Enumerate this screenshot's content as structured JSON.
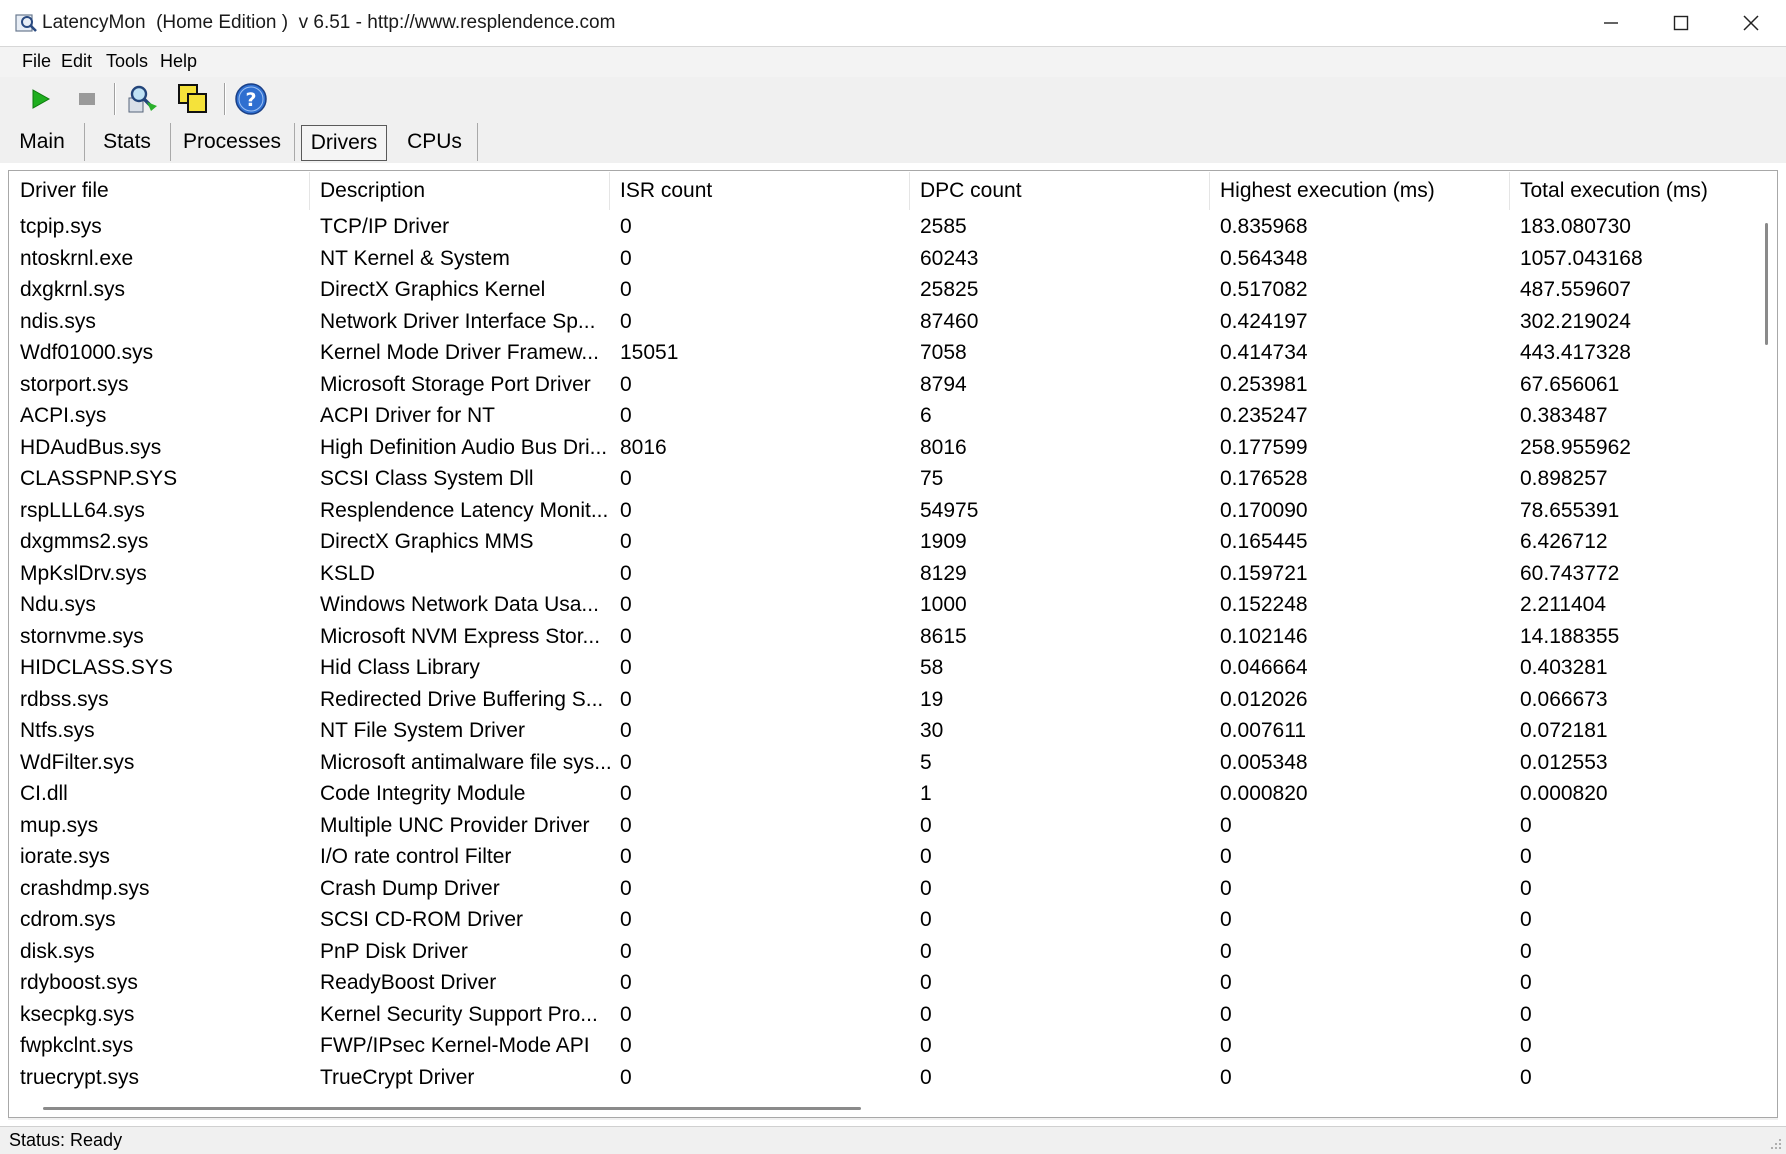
{
  "window": {
    "title": "LatencyMon  (Home Edition )  v 6.51 - http://www.resplendence.com",
    "icons": {
      "app": "latencymon-app-icon",
      "minimize": "minimize-icon",
      "maximize": "maximize-icon",
      "close": "close-icon"
    }
  },
  "menu": {
    "items": [
      "File",
      "Edit",
      "Tools",
      "Help"
    ]
  },
  "toolbar": {
    "buttons": [
      {
        "name": "start",
        "icon": "play-icon",
        "color": "#1fae1f"
      },
      {
        "name": "stop",
        "icon": "stop-icon",
        "color": "#9a9a9a"
      },
      {
        "name": "analyze",
        "icon": "magnifier-icon"
      },
      {
        "name": "windows",
        "icon": "windows-icon"
      },
      {
        "name": "help",
        "icon": "help-icon",
        "color": "#2f6fd0"
      }
    ]
  },
  "tabs": [
    {
      "label": "Main",
      "active": false
    },
    {
      "label": "Stats",
      "active": false
    },
    {
      "label": "Processes",
      "active": false
    },
    {
      "label": "Drivers",
      "active": true
    },
    {
      "label": "CPUs",
      "active": false
    }
  ],
  "table": {
    "columns": [
      "Driver file",
      "Description",
      "ISR count",
      "DPC count",
      "Highest execution (ms)",
      "Total execution (ms)"
    ],
    "rows": [
      [
        "tcpip.sys",
        "TCP/IP Driver",
        "0",
        "2585",
        "0.835968",
        "183.080730"
      ],
      [
        "ntoskrnl.exe",
        "NT Kernel & System",
        "0",
        "60243",
        "0.564348",
        "1057.043168"
      ],
      [
        "dxgkrnl.sys",
        "DirectX Graphics Kernel",
        "0",
        "25825",
        "0.517082",
        "487.559607"
      ],
      [
        "ndis.sys",
        "Network Driver Interface Sp...",
        "0",
        "87460",
        "0.424197",
        "302.219024"
      ],
      [
        "Wdf01000.sys",
        "Kernel Mode Driver Framew...",
        "15051",
        "7058",
        "0.414734",
        "443.417328"
      ],
      [
        "storport.sys",
        "Microsoft Storage Port Driver",
        "0",
        "8794",
        "0.253981",
        "67.656061"
      ],
      [
        "ACPI.sys",
        "ACPI Driver for NT",
        "0",
        "6",
        "0.235247",
        "0.383487"
      ],
      [
        "HDAudBus.sys",
        "High Definition Audio Bus Dri...",
        "8016",
        "8016",
        "0.177599",
        "258.955962"
      ],
      [
        "CLASSPNP.SYS",
        "SCSI Class System Dll",
        "0",
        "75",
        "0.176528",
        "0.898257"
      ],
      [
        "rspLLL64.sys",
        "Resplendence Latency Monit...",
        "0",
        "54975",
        "0.170090",
        "78.655391"
      ],
      [
        "dxgmms2.sys",
        "DirectX Graphics MMS",
        "0",
        "1909",
        "0.165445",
        "6.426712"
      ],
      [
        "MpKslDrv.sys",
        "KSLD",
        "0",
        "8129",
        "0.159721",
        "60.743772"
      ],
      [
        "Ndu.sys",
        "Windows Network Data Usa...",
        "0",
        "1000",
        "0.152248",
        "2.211404"
      ],
      [
        "stornvme.sys",
        "Microsoft NVM Express Stor...",
        "0",
        "8615",
        "0.102146",
        "14.188355"
      ],
      [
        "HIDCLASS.SYS",
        "Hid Class Library",
        "0",
        "58",
        "0.046664",
        "0.403281"
      ],
      [
        "rdbss.sys",
        "Redirected Drive Buffering S...",
        "0",
        "19",
        "0.012026",
        "0.066673"
      ],
      [
        "Ntfs.sys",
        "NT File System Driver",
        "0",
        "30",
        "0.007611",
        "0.072181"
      ],
      [
        "WdFilter.sys",
        "Microsoft antimalware file sys...",
        "0",
        "5",
        "0.005348",
        "0.012553"
      ],
      [
        "CI.dll",
        "Code Integrity Module",
        "0",
        "1",
        "0.000820",
        "0.000820"
      ],
      [
        "mup.sys",
        "Multiple UNC Provider Driver",
        "0",
        "0",
        "0",
        "0"
      ],
      [
        "iorate.sys",
        "I/O rate control Filter",
        "0",
        "0",
        "0",
        "0"
      ],
      [
        "crashdmp.sys",
        "Crash Dump Driver",
        "0",
        "0",
        "0",
        "0"
      ],
      [
        "cdrom.sys",
        "SCSI CD-ROM Driver",
        "0",
        "0",
        "0",
        "0"
      ],
      [
        "disk.sys",
        "PnP Disk Driver",
        "0",
        "0",
        "0",
        "0"
      ],
      [
        "rdyboost.sys",
        "ReadyBoost Driver",
        "0",
        "0",
        "0",
        "0"
      ],
      [
        "ksecpkg.sys",
        "Kernel Security Support Pro...",
        "0",
        "0",
        "0",
        "0"
      ],
      [
        "fwpkclnt.sys",
        "FWP/IPsec Kernel-Mode API",
        "0",
        "0",
        "0",
        "0"
      ],
      [
        "truecrypt.sys",
        "TrueCrypt Driver",
        "0",
        "0",
        "0",
        "0"
      ]
    ]
  },
  "status": {
    "text": "Status: Ready"
  }
}
